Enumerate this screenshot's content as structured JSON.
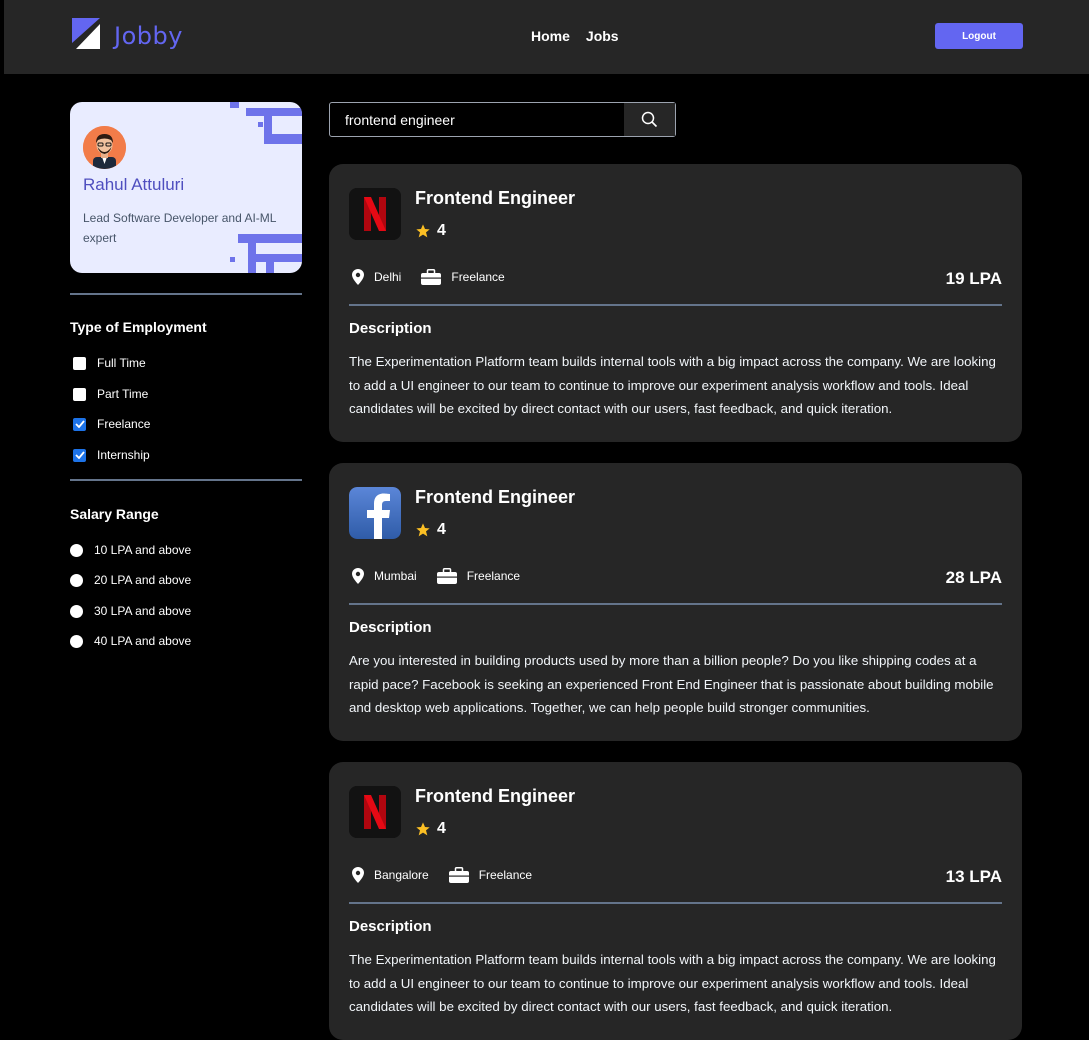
{
  "header": {
    "brand": "Jobby",
    "nav": [
      "Home",
      "Jobs"
    ],
    "logout_label": "Logout"
  },
  "profile": {
    "name": "Rahul Attuluri",
    "bio": "Lead Software Developer and AI-ML expert"
  },
  "filters": {
    "employment_title": "Type of Employment",
    "employment": [
      {
        "label": "Full Time",
        "checked": false
      },
      {
        "label": "Part Time",
        "checked": false
      },
      {
        "label": "Freelance",
        "checked": true
      },
      {
        "label": "Internship",
        "checked": true
      }
    ],
    "salary_title": "Salary Range",
    "salary": [
      "10 LPA and above",
      "20 LPA and above",
      "30 LPA and above",
      "40 LPA and above"
    ]
  },
  "search": {
    "value": "frontend engineer"
  },
  "jobs": [
    {
      "company_icon": "netflix-logo",
      "title": "Frontend Engineer",
      "rating": "4",
      "location": "Delhi",
      "employment_type": "Freelance",
      "package": "19 LPA",
      "description_label": "Description",
      "description": "The Experimentation Platform team builds internal tools with a big impact across the company. We are looking to add a UI engineer to our team to continue to improve our experiment analysis workflow and tools. Ideal candidates will be excited by direct contact with our users, fast feedback, and quick iteration."
    },
    {
      "company_icon": "facebook-logo",
      "title": "Frontend Engineer",
      "rating": "4",
      "location": "Mumbai",
      "employment_type": "Freelance",
      "package": "28 LPA",
      "description_label": "Description",
      "description": "Are you interested in building products used by more than a billion people? Do you like shipping codes at a rapid pace? Facebook is seeking an experienced Front End Engineer that is passionate about building mobile and desktop web applications. Together, we can help people build stronger communities."
    },
    {
      "company_icon": "netflix-logo",
      "title": "Frontend Engineer",
      "rating": "4",
      "location": "Bangalore",
      "employment_type": "Freelance",
      "package": "13 LPA",
      "description_label": "Description",
      "description": "The Experimentation Platform team builds internal tools with a big impact across the company. We are looking to add a UI engineer to our team to continue to improve our experiment analysis workflow and tools. Ideal candidates will be excited by direct contact with our users, fast feedback, and quick iteration."
    }
  ],
  "colors": {
    "accent": "#6366f1",
    "card": "#262626",
    "checkbox_checked": "#1d73e8",
    "star": "#fbbf24"
  }
}
